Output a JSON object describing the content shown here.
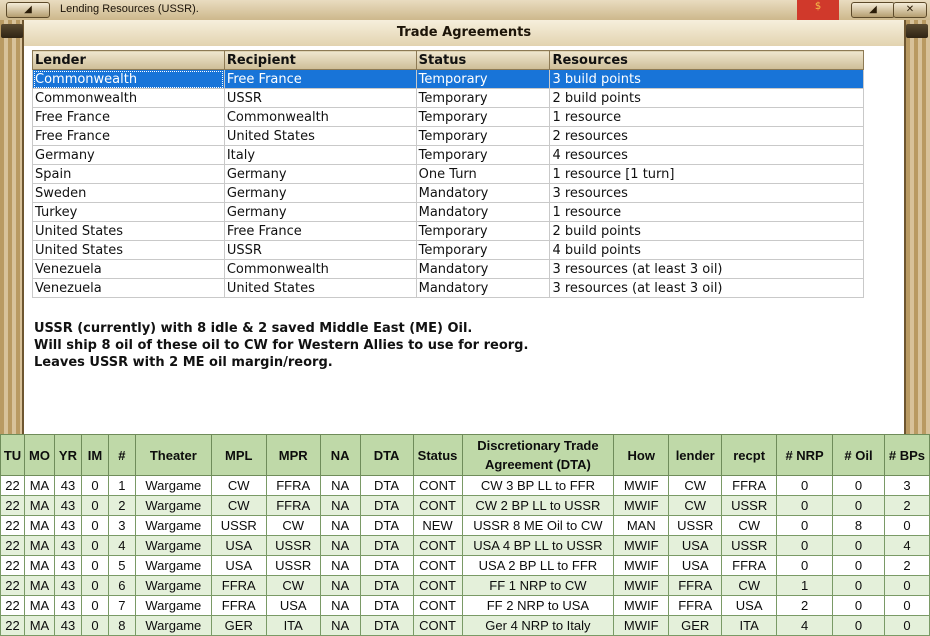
{
  "window": {
    "title": "Lending Resources (USSR).",
    "min_icon": "◢",
    "max_icon": "◢",
    "close_icon": "✕",
    "flag_text": "$"
  },
  "panel": {
    "title": "Trade Agreements"
  },
  "trade_table": {
    "headers": [
      "Lender",
      "Recipient",
      "Status",
      "Resources"
    ],
    "rows": [
      [
        "Commonwealth",
        "Free France",
        "Temporary",
        "3 build points"
      ],
      [
        "Commonwealth",
        "USSR",
        "Temporary",
        "2 build points"
      ],
      [
        "Free France",
        "Commonwealth",
        "Temporary",
        "1 resource"
      ],
      [
        "Free France",
        "United States",
        "Temporary",
        "2 resources"
      ],
      [
        "Germany",
        "Italy",
        "Temporary",
        "4 resources"
      ],
      [
        "Spain",
        "Germany",
        "One Turn",
        "1 resource [1 turn]"
      ],
      [
        "Sweden",
        "Germany",
        "Mandatory",
        "3 resources"
      ],
      [
        "Turkey",
        "Germany",
        "Mandatory",
        "1 resource"
      ],
      [
        "United States",
        "Free France",
        "Temporary",
        "2 build points"
      ],
      [
        "United States",
        "USSR",
        "Temporary",
        "4 build points"
      ],
      [
        "Venezuela",
        "Commonwealth",
        "Mandatory",
        "3 resources (at least 3 oil)"
      ],
      [
        "Venezuela",
        "United States",
        "Mandatory",
        "3 resources (at least 3 oil)"
      ]
    ],
    "selected_row": 0
  },
  "notes": [
    "USSR (currently) with 8 idle & 2 saved Middle East (ME) Oil.",
    "Will ship 8 oil of these oil to CW for Western Allies to use for reorg.",
    "Leaves USSR with 2 ME oil margin/reorg."
  ],
  "sheet": {
    "headers": [
      "TU",
      "MO",
      "YR",
      "IM",
      "#",
      "Theater",
      "MPL",
      "MPR",
      "NA",
      "DTA",
      "Status",
      "Discretionary Trade Agreement (DTA)",
      "How",
      "lender",
      "recpt",
      "# NRP",
      "# Oil",
      "# BPs"
    ],
    "rows": [
      [
        "22",
        "MA",
        "43",
        "0",
        "1",
        "Wargame",
        "CW",
        "FFRA",
        "NA",
        "DTA",
        "CONT",
        "CW 3 BP LL to FFR",
        "MWIF",
        "CW",
        "FFRA",
        "0",
        "0",
        "3"
      ],
      [
        "22",
        "MA",
        "43",
        "0",
        "2",
        "Wargame",
        "CW",
        "FFRA",
        "NA",
        "DTA",
        "CONT",
        "CW 2 BP LL to USSR",
        "MWIF",
        "CW",
        "USSR",
        "0",
        "0",
        "2"
      ],
      [
        "22",
        "MA",
        "43",
        "0",
        "3",
        "Wargame",
        "USSR",
        "CW",
        "NA",
        "DTA",
        "NEW",
        "USSR 8 ME Oil to CW",
        "MAN",
        "USSR",
        "CW",
        "0",
        "8",
        "0"
      ],
      [
        "22",
        "MA",
        "43",
        "0",
        "4",
        "Wargame",
        "USA",
        "USSR",
        "NA",
        "DTA",
        "CONT",
        "USA 4 BP LL to USSR",
        "MWIF",
        "USA",
        "USSR",
        "0",
        "0",
        "4"
      ],
      [
        "22",
        "MA",
        "43",
        "0",
        "5",
        "Wargame",
        "USA",
        "USSR",
        "NA",
        "DTA",
        "CONT",
        "USA 2 BP LL to FFR",
        "MWIF",
        "USA",
        "FFRA",
        "0",
        "0",
        "2"
      ],
      [
        "22",
        "MA",
        "43",
        "0",
        "6",
        "Wargame",
        "FFRA",
        "CW",
        "NA",
        "DTA",
        "CONT",
        "FF 1 NRP to CW",
        "MWIF",
        "FFRA",
        "CW",
        "1",
        "0",
        "0"
      ],
      [
        "22",
        "MA",
        "43",
        "0",
        "7",
        "Wargame",
        "FFRA",
        "USA",
        "NA",
        "DTA",
        "CONT",
        "FF 2 NRP to USA",
        "MWIF",
        "FFRA",
        "USA",
        "2",
        "0",
        "0"
      ],
      [
        "22",
        "MA",
        "43",
        "0",
        "8",
        "Wargame",
        "GER",
        "ITA",
        "NA",
        "DTA",
        "CONT",
        "Ger 4 NRP to Italy",
        "MWIF",
        "GER",
        "ITA",
        "4",
        "0",
        "0"
      ]
    ]
  },
  "colors": {
    "selection": "#1874d8",
    "sheet_header": "#bfd9a8",
    "frame": "#c8b48a"
  }
}
